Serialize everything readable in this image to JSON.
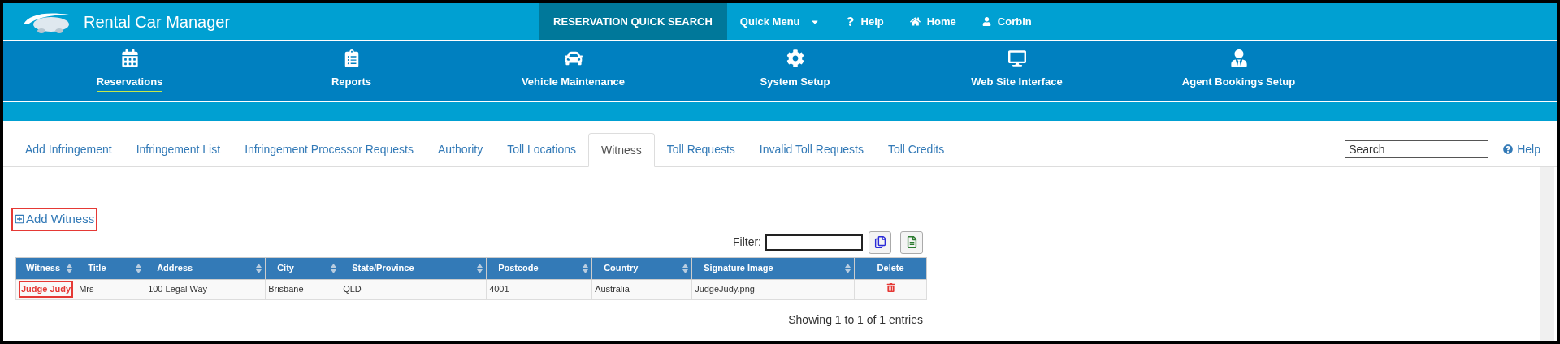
{
  "app_title": "Rental Car Manager",
  "top_menu": [
    {
      "label": "RESERVATION QUICK SEARCH",
      "kind": "search",
      "selected": true
    },
    {
      "label": "Quick Menu",
      "kind": "dropdown",
      "selected": false
    },
    {
      "label": "Help",
      "kind": "help",
      "selected": false
    },
    {
      "label": "Home",
      "kind": "home",
      "selected": false
    },
    {
      "label": "Corbin",
      "kind": "user",
      "selected": false
    }
  ],
  "nav": [
    {
      "label": "Reservations",
      "kind": "calendar",
      "selected": true
    },
    {
      "label": "Reports",
      "kind": "checklist",
      "selected": false
    },
    {
      "label": "Vehicle Maintenance",
      "kind": "car",
      "selected": false
    },
    {
      "label": "System Setup",
      "kind": "gear",
      "selected": false
    },
    {
      "label": "Web Site Interface",
      "kind": "monitor",
      "selected": false
    },
    {
      "label": "Agent Bookings Setup",
      "kind": "agent",
      "selected": false
    }
  ],
  "tabs": [
    {
      "label": "Add Infringement",
      "selected": false
    },
    {
      "label": "Infringement List",
      "selected": false
    },
    {
      "label": "Infringement Processor Requests",
      "selected": false
    },
    {
      "label": "Authority",
      "selected": false
    },
    {
      "label": "Toll Locations",
      "selected": false
    },
    {
      "label": "Witness",
      "selected": true
    },
    {
      "label": "Toll Requests",
      "selected": false
    },
    {
      "label": "Invalid Toll Requests",
      "selected": false
    },
    {
      "label": "Toll Credits",
      "selected": false
    }
  ],
  "search": {
    "placeholder": "Search"
  },
  "help_link": "Help",
  "add_link": "Add Witness",
  "filter_label": "Filter:",
  "table": {
    "columns": [
      {
        "label": "Witness",
        "sortable": true
      },
      {
        "label": "Title",
        "sortable": true
      },
      {
        "label": "Address",
        "sortable": true
      },
      {
        "label": "City",
        "sortable": true
      },
      {
        "label": "State/Province",
        "sortable": true
      },
      {
        "label": "Postcode",
        "sortable": true
      },
      {
        "label": "Country",
        "sortable": true
      },
      {
        "label": "Signature Image",
        "sortable": true
      },
      {
        "label": "Delete",
        "sortable": false
      }
    ],
    "rows": [
      {
        "cells": [
          "Judge Judy",
          "Mrs",
          "100 Legal Way",
          "Brisbane",
          "QLD",
          "4001",
          "Australia",
          "JudgeJudy.png"
        ]
      }
    ]
  },
  "footer": "Showing 1 to 1 of 1 entries"
}
